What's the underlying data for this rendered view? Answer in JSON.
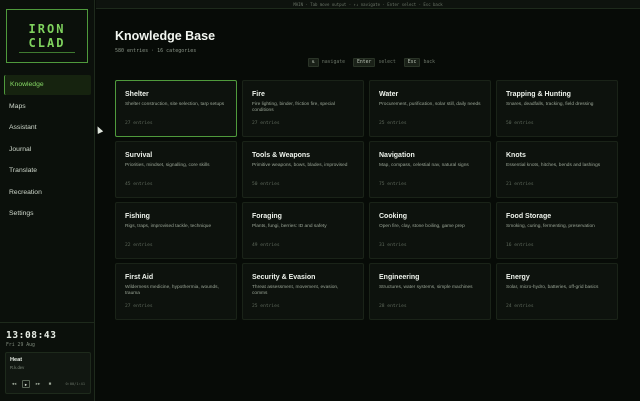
{
  "brand": {
    "line1": "IRON",
    "line2": "CLAD"
  },
  "nav": {
    "items": [
      {
        "label": "Knowledge",
        "active": true
      },
      {
        "label": "Maps",
        "active": false
      },
      {
        "label": "Assistant",
        "active": false
      },
      {
        "label": "Journal",
        "active": false
      },
      {
        "label": "Translate",
        "active": false
      },
      {
        "label": "Recreation",
        "active": false
      },
      {
        "label": "Settings",
        "active": false
      }
    ]
  },
  "clock": {
    "time": "13:08:43",
    "date": "Fri 29 Aug"
  },
  "player": {
    "track": "Heat",
    "artist": "R.k.dev",
    "position": "0:00/1:41",
    "controls": {
      "prev": "◂◂",
      "play": "▸",
      "next": "▸▸",
      "stop": "■"
    }
  },
  "topbar": {
    "text": "MAIN · Tab move output · ↑↓ navigate · Enter select · Esc back"
  },
  "page": {
    "title": "Knowledge Base",
    "subtitle": "580 entries · 16 categories"
  },
  "hints": [
    {
      "key": "⇅",
      "label": "navigate"
    },
    {
      "key": "Enter",
      "label": "select"
    },
    {
      "key": "Esc",
      "label": "back"
    }
  ],
  "categories": [
    {
      "title": "Shelter",
      "desc": "Shelter construction, site selection, tarp setups",
      "count": "27 entries",
      "selected": true
    },
    {
      "title": "Fire",
      "desc": "Fire lighting, binder, friction fire, special conditions",
      "count": "27 entries"
    },
    {
      "title": "Water",
      "desc": "Procurement, purification, solar still, daily needs",
      "count": "25 entries"
    },
    {
      "title": "Trapping & Hunting",
      "desc": "Snares, deadfalls, tracking, field dressing",
      "count": "50 entries"
    },
    {
      "title": "Survival",
      "desc": "Priorities, mindset, signalling, core skills",
      "count": "45 entries"
    },
    {
      "title": "Tools & Weapons",
      "desc": "Primitive weapons, bows, blades, improvised",
      "count": "50 entries"
    },
    {
      "title": "Navigation",
      "desc": "Map, compass, celestial nav, natural signs",
      "count": "75 entries"
    },
    {
      "title": "Knots",
      "desc": "Essential knots, hitches, bends and lashings",
      "count": "21 entries"
    },
    {
      "title": "Fishing",
      "desc": "Rigs, traps, improvised tackle, technique",
      "count": "22 entries"
    },
    {
      "title": "Foraging",
      "desc": "Plants, fungi, berries: ID and safety",
      "count": "49 entries"
    },
    {
      "title": "Cooking",
      "desc": "Open fire, clay, stone boiling, game prep",
      "count": "31 entries"
    },
    {
      "title": "Food Storage",
      "desc": "Smoking, curing, fermenting, preservation",
      "count": "16 entries"
    },
    {
      "title": "First Aid",
      "desc": "Wilderness medicine, hypothermia, wounds, trauma",
      "count": "27 entries"
    },
    {
      "title": "Security & Evasion",
      "desc": "Threat assessment, movement, evasion, comms",
      "count": "25 entries"
    },
    {
      "title": "Engineering",
      "desc": "Structures, water systems, simple machines",
      "count": "28 entries"
    },
    {
      "title": "Energy",
      "desc": "Solar, micro-hydro, batteries, off-grid basics",
      "count": "24 entries"
    }
  ]
}
